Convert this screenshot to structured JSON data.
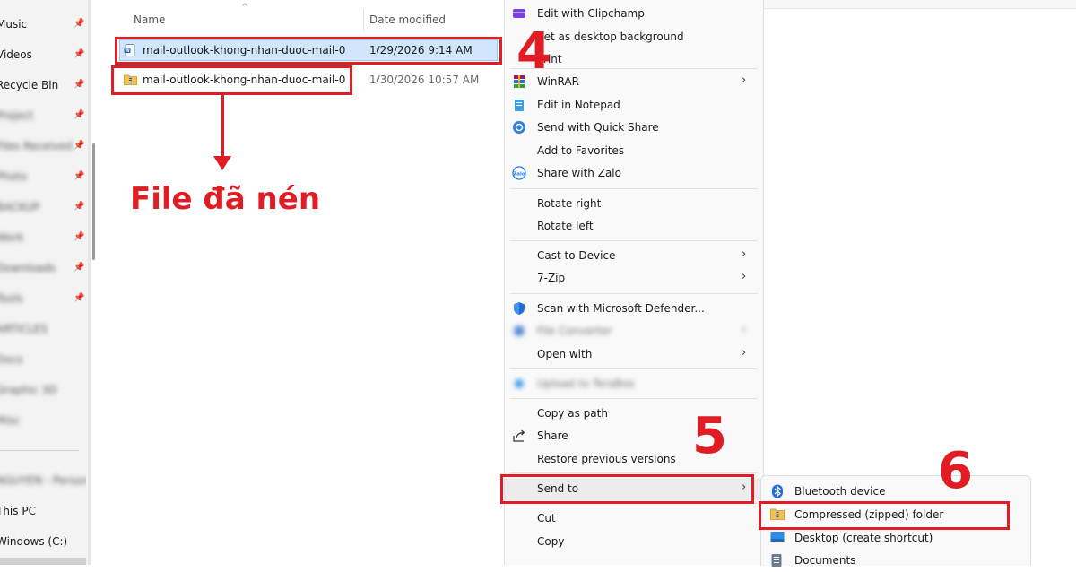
{
  "nav": {
    "items": [
      {
        "label": "Music",
        "pinned": true,
        "blurred": false
      },
      {
        "label": "Videos",
        "pinned": true,
        "blurred": false
      },
      {
        "label": "Recycle Bin",
        "pinned": true,
        "blurred": false
      },
      {
        "label": "Project",
        "pinned": true,
        "blurred": true
      },
      {
        "label": "Files Received",
        "pinned": true,
        "blurred": true
      },
      {
        "label": "Photo",
        "pinned": true,
        "blurred": true
      },
      {
        "label": "BACKUP",
        "pinned": true,
        "blurred": true
      },
      {
        "label": "Work",
        "pinned": true,
        "blurred": true
      },
      {
        "label": "Downloads",
        "pinned": true,
        "blurred": true
      },
      {
        "label": "Tools",
        "pinned": true,
        "blurred": true
      },
      {
        "label": "ARTICLES",
        "pinned": false,
        "blurred": true
      },
      {
        "label": "Docs",
        "pinned": false,
        "blurred": true
      },
      {
        "label": "Graphic 3D",
        "pinned": false,
        "blurred": true
      },
      {
        "label": "Misc",
        "pinned": false,
        "blurred": true
      }
    ],
    "bottom_items": [
      {
        "label": "NGUYEN - Personal",
        "blurred": true
      },
      {
        "label": "This PC",
        "blurred": false
      },
      {
        "label": "Windows (C:)",
        "blurred": false
      }
    ]
  },
  "file_list": {
    "col_name": "Name",
    "col_date": "Date modified",
    "rows": [
      {
        "name": "mail-outlook-khong-nhan-duoc-mail-0",
        "date": "1/29/2026 9:14 AM",
        "icon": "word-document-icon",
        "selected": true
      },
      {
        "name": "mail-outlook-khong-nhan-duoc-mail-0",
        "date": "1/30/2026 10:57 AM",
        "icon": "zip-folder-icon",
        "selected": false
      }
    ]
  },
  "context_menu": {
    "items": [
      {
        "label": "Edit with Clipchamp",
        "icon": "clipchamp-icon",
        "blurred": false
      },
      {
        "label": "Set as desktop background",
        "icon": "",
        "blurred": false
      },
      {
        "label": "Print",
        "icon": "",
        "blurred": false
      },
      {
        "label": "WinRAR",
        "icon": "winrar-icon",
        "submenu": true,
        "blurred": false
      },
      {
        "label": "Edit in Notepad",
        "icon": "notepad-icon",
        "blurred": false
      },
      {
        "label": "Send with Quick Share",
        "icon": "quick-share-icon",
        "blurred": false
      },
      {
        "label": "Add to Favorites",
        "icon": "",
        "blurred": false
      },
      {
        "label": "Share with Zalo",
        "icon": "zalo-icon",
        "blurred": false
      },
      {
        "label": "Rotate right",
        "icon": "",
        "blurred": false
      },
      {
        "label": "Rotate left",
        "icon": "",
        "blurred": false
      },
      {
        "label": "Cast to Device",
        "icon": "",
        "submenu": true,
        "blurred": false
      },
      {
        "label": "7-Zip",
        "icon": "",
        "submenu": true,
        "blurred": false
      },
      {
        "label": "Scan with Microsoft Defender...",
        "icon": "defender-shield-icon",
        "blurred": false
      },
      {
        "label": "File Converter",
        "icon": "file-converter-icon",
        "submenu": true,
        "blurred": true
      },
      {
        "label": "Open with",
        "icon": "",
        "submenu": true,
        "blurred": false
      },
      {
        "label": "Upload to TeraBox",
        "icon": "terabox-icon",
        "blurred": true
      },
      {
        "label": "Copy as path",
        "icon": "",
        "blurred": false
      },
      {
        "label": "Share",
        "icon": "share-icon",
        "blurred": false
      },
      {
        "label": "Restore previous versions",
        "icon": "",
        "blurred": false
      },
      {
        "label": "Send to",
        "icon": "",
        "submenu": true,
        "blurred": false
      },
      {
        "label": "Cut",
        "icon": "",
        "blurred": false
      },
      {
        "label": "Copy",
        "icon": "",
        "blurred": false
      }
    ]
  },
  "send_to_menu": {
    "items": [
      {
        "label": "Bluetooth device",
        "icon": "bluetooth-icon"
      },
      {
        "label": "Compressed (zipped) folder",
        "icon": "zip-folder-icon"
      },
      {
        "label": "Desktop (create shortcut)",
        "icon": "desktop-icon"
      },
      {
        "label": "Documents",
        "icon": "documents-icon"
      }
    ]
  },
  "annotations": {
    "note": "File đã nén",
    "step4": "4",
    "step5": "5",
    "step6": "6",
    "color": "#e01c24"
  },
  "colors": {
    "selection": "#cfe6fb",
    "selection_border": "#99c9f1",
    "menu_bg": "#f9f9f9",
    "nav_bg": "#f3f3f3"
  }
}
